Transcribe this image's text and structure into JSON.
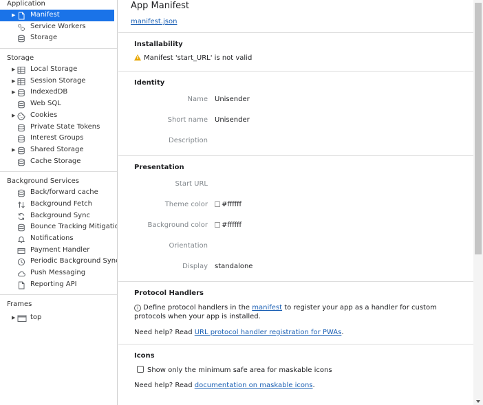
{
  "sidebar": {
    "application": {
      "title": "Application",
      "items": [
        {
          "label": "Manifest",
          "icon": "file-icon",
          "arrow": true,
          "selected": true
        },
        {
          "label": "Service Workers",
          "icon": "gears-icon",
          "arrow": false
        },
        {
          "label": "Storage",
          "icon": "database-icon",
          "arrow": false
        }
      ]
    },
    "storage": {
      "title": "Storage",
      "items": [
        {
          "label": "Local Storage",
          "icon": "table-icon",
          "arrow": true
        },
        {
          "label": "Session Storage",
          "icon": "table-icon",
          "arrow": true
        },
        {
          "label": "IndexedDB",
          "icon": "database-icon",
          "arrow": true
        },
        {
          "label": "Web SQL",
          "icon": "database-icon",
          "arrow": false
        },
        {
          "label": "Cookies",
          "icon": "cookie-icon",
          "arrow": true
        },
        {
          "label": "Private State Tokens",
          "icon": "database-icon",
          "arrow": false
        },
        {
          "label": "Interest Groups",
          "icon": "database-icon",
          "arrow": false
        },
        {
          "label": "Shared Storage",
          "icon": "database-icon",
          "arrow": true
        },
        {
          "label": "Cache Storage",
          "icon": "database-icon",
          "arrow": false
        }
      ]
    },
    "background_services": {
      "title": "Background Services",
      "items": [
        {
          "label": "Back/forward cache",
          "icon": "database-icon"
        },
        {
          "label": "Background Fetch",
          "icon": "updown-arrows-icon"
        },
        {
          "label": "Background Sync",
          "icon": "sync-icon"
        },
        {
          "label": "Bounce Tracking Mitigations",
          "icon": "database-icon"
        },
        {
          "label": "Notifications",
          "icon": "bell-icon"
        },
        {
          "label": "Payment Handler",
          "icon": "card-icon"
        },
        {
          "label": "Periodic Background Sync",
          "icon": "clock-icon"
        },
        {
          "label": "Push Messaging",
          "icon": "cloud-icon"
        },
        {
          "label": "Reporting API",
          "icon": "file-icon"
        }
      ]
    },
    "frames": {
      "title": "Frames",
      "items": [
        {
          "label": "top",
          "icon": "frame-icon",
          "arrow": true
        }
      ]
    }
  },
  "main": {
    "title": "App Manifest",
    "manifest_link": "manifest.json",
    "installability": {
      "heading": "Installability",
      "warning": "Manifest 'start_URL' is not valid"
    },
    "identity": {
      "heading": "Identity",
      "fields": [
        {
          "key": "Name",
          "value": "Unisender"
        },
        {
          "key": "Short name",
          "value": "Unisender"
        },
        {
          "key": "Description",
          "value": ""
        }
      ]
    },
    "presentation": {
      "heading": "Presentation",
      "start_url": {
        "key": "Start URL",
        "value": ""
      },
      "theme_color": {
        "key": "Theme color",
        "value": "#ffffff"
      },
      "background_color": {
        "key": "Background color",
        "value": "#ffffff"
      },
      "orientation": {
        "key": "Orientation",
        "value": ""
      },
      "display": {
        "key": "Display",
        "value": "standalone"
      }
    },
    "protocol_handlers": {
      "heading": "Protocol Handlers",
      "text_before": "Define protocol handlers in the ",
      "link": "manifest",
      "text_after": " to register your app as a handler for custom protocols when your app is installed.",
      "help_prefix": "Need help? Read ",
      "help_link": "URL protocol handler registration for PWAs",
      "help_suffix": "."
    },
    "icons": {
      "heading": "Icons",
      "checkbox_label": "Show only the minimum safe area for maskable icons",
      "checkbox_checked": false,
      "help_prefix": "Need help? Read ",
      "help_link": "documentation on maskable icons",
      "help_suffix": "."
    }
  },
  "colors": {
    "selection": "#1a73e8",
    "link": "#1a5fb4",
    "warning": "#e8a600"
  }
}
